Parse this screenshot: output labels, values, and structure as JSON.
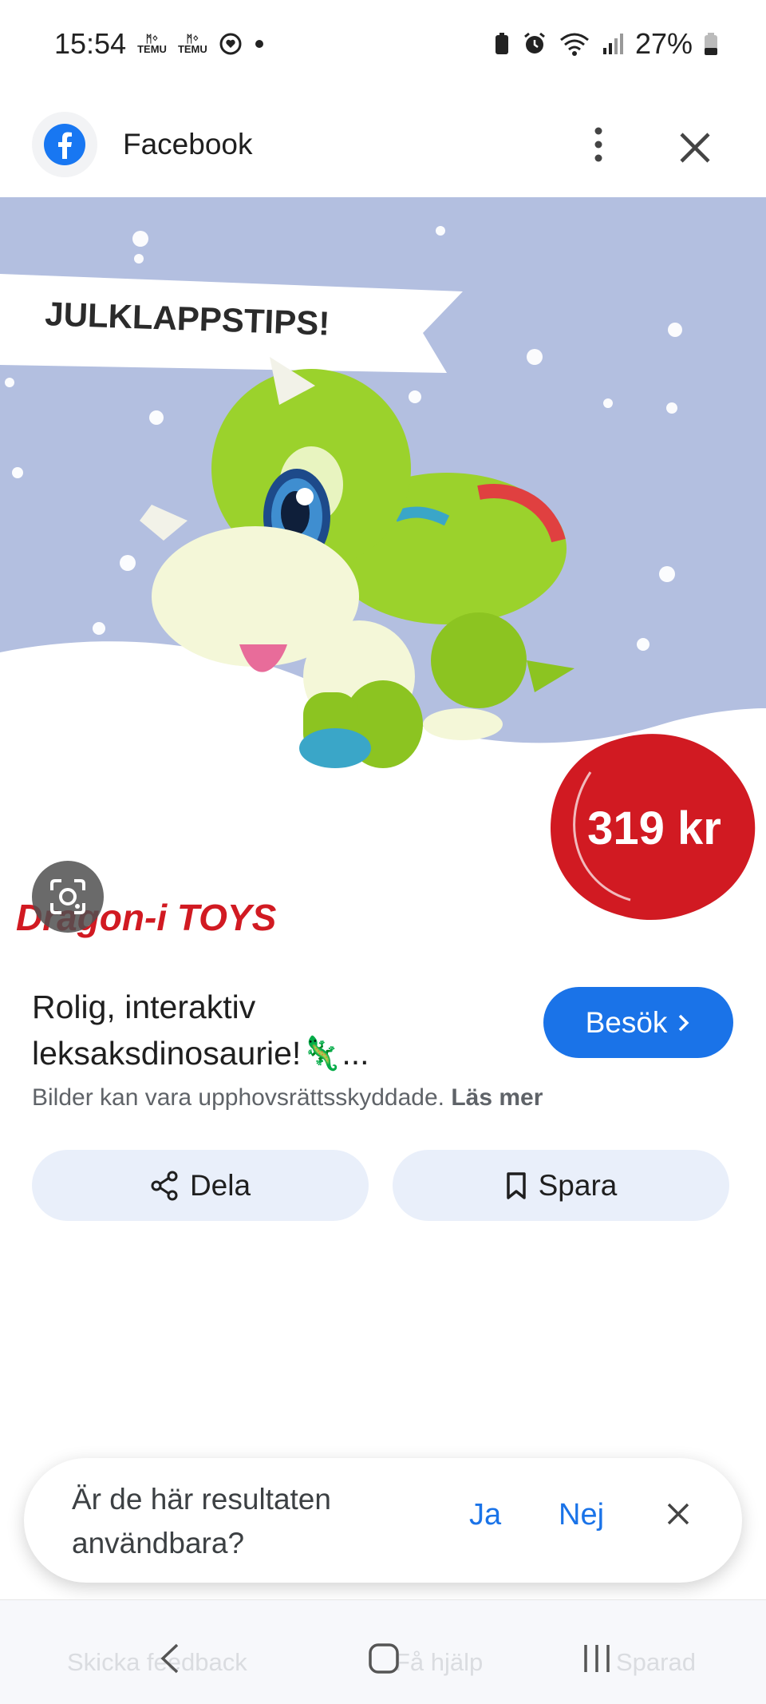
{
  "status_bar": {
    "time": "15:54",
    "temu_label_1": "TEMU",
    "temu_label_2": "TEMU",
    "battery": "27%"
  },
  "header": {
    "app_title": "Facebook",
    "icons": [
      "facebook-logo-icon",
      "more-vert-icon",
      "close-icon"
    ]
  },
  "image": {
    "banner_text": "JULKLAPPSTIPS!",
    "price_badge": "319 kr",
    "brand_logo": "Dragon-i TOYS"
  },
  "result": {
    "title_line_1": "Rolig, interaktiv",
    "title_line_2": "leksaksdinosaurie!🦎...",
    "visit_label": "Besök",
    "copyright_text": "Bilder kan vara upphovsrättsskyddade.",
    "read_more": "Läs mer"
  },
  "actions": {
    "share_label": "Dela",
    "save_label": "Spara"
  },
  "feedback": {
    "question_line_1": "Är de här resultaten",
    "question_line_2": "användbara?",
    "yes": "Ja",
    "no": "Nej"
  },
  "bottom_bar": {
    "send_feedback": "Skicka feedback",
    "get_help": "Få hjälp",
    "saved": "Sparad"
  },
  "colors": {
    "accent": "#1a73e8",
    "chip_bg": "#e9effa",
    "sky": "#b3bfe0",
    "price_red": "#d11a22",
    "dino_green": "#9bd22c"
  }
}
